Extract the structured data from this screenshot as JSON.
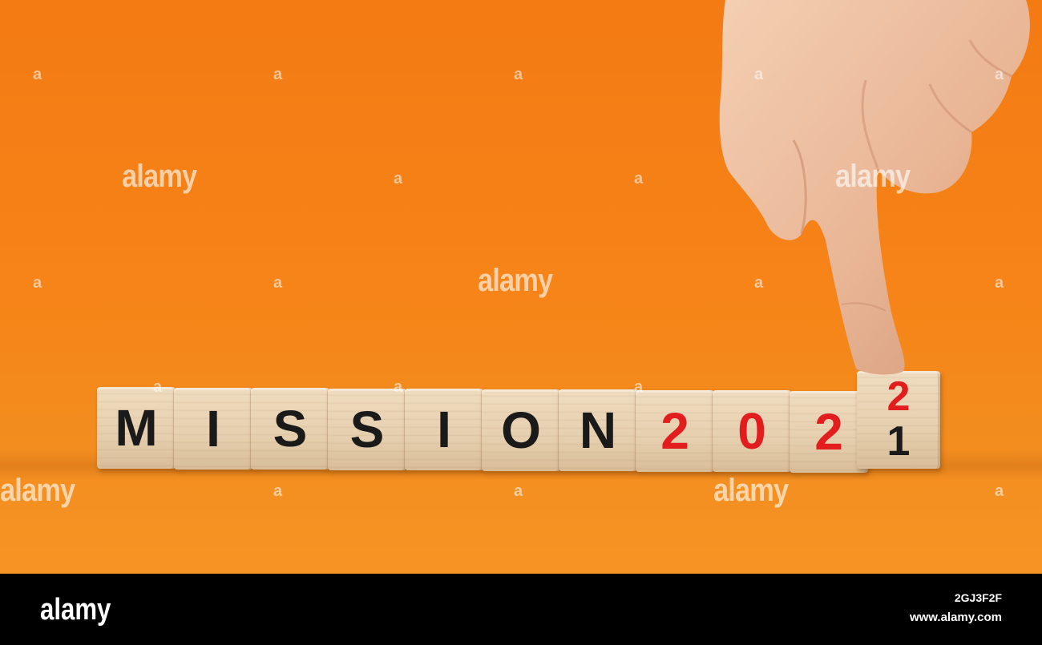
{
  "photo": {
    "background_color": "#f5841a",
    "cube_color": "#e9d4b4",
    "text_black": "#1a1a1a",
    "text_red": "#e11d1d",
    "cubes": [
      {
        "char": "M",
        "color": "#1a1a1a"
      },
      {
        "char": "I",
        "color": "#1a1a1a"
      },
      {
        "char": "S",
        "color": "#1a1a1a"
      },
      {
        "char": "S",
        "color": "#1a1a1a"
      },
      {
        "char": "I",
        "color": "#1a1a1a"
      },
      {
        "char": "O",
        "color": "#1a1a1a"
      },
      {
        "char": "N",
        "color": "#1a1a1a"
      },
      {
        "char": "2",
        "color": "#e11d1d"
      },
      {
        "char": "0",
        "color": "#e11d1d"
      },
      {
        "char": "2",
        "color": "#e11d1d"
      }
    ],
    "last_cube": {
      "top_char": "2",
      "bottom_char": "1",
      "top_color": "#e11d1d",
      "bottom_color": "#1a1a1a"
    },
    "hand_icon": "pointing-hand-icon"
  },
  "watermark": {
    "text": "alamy",
    "dot": "a"
  },
  "footer": {
    "logo": "alamy",
    "image_id": "2GJ3F2F",
    "url": "www.alamy.com"
  }
}
